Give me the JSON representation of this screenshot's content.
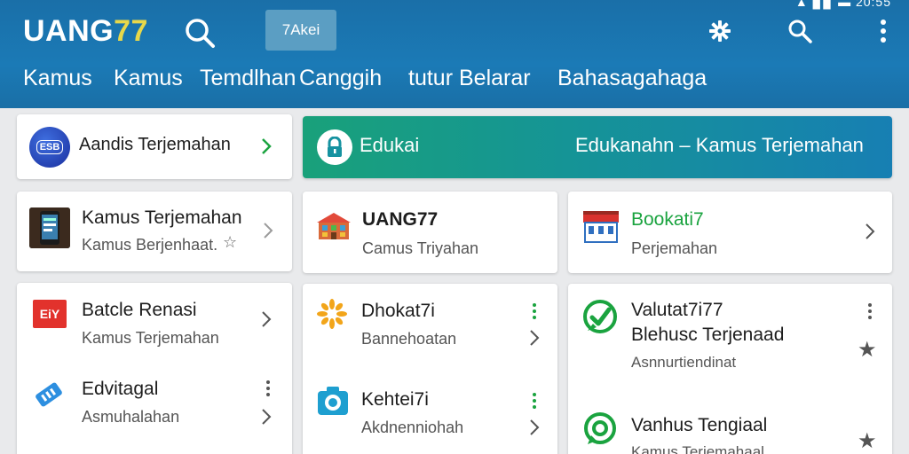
{
  "header": {
    "status_text": "▲ ▊▊ ▬ 20:55",
    "logo_main": "UANG",
    "logo_accent": "77",
    "search_chip": "7Akei",
    "nav": [
      "Kamus",
      "Kamus",
      "Temdlhan",
      "Canggih",
      "tutur",
      "Belarar",
      "Bahasagahaga"
    ]
  },
  "top_card": {
    "title": "Aandis Terjemahan",
    "icon_text": "ESB"
  },
  "banner": {
    "left_text": "Edukai",
    "right_text": "Edukanahn  –  Kamus Terjemahan"
  },
  "row1": [
    {
      "title": "Kamus Terjemahan",
      "subtitle": "Kamus Berjenhaat.",
      "star": "☆"
    },
    {
      "title": "UANG77",
      "subtitle": "Camus Triyahan"
    },
    {
      "title": "Bookati7",
      "subtitle": "Perjemahan"
    }
  ],
  "col1": [
    {
      "title": "Batcle Renasi",
      "subtitle": "Kamus Terjemahan",
      "icon_text": "EiY"
    },
    {
      "title": "Edvitagal",
      "subtitle": "Asmuhalahan"
    }
  ],
  "col2": [
    {
      "title": "Dhokat7i",
      "subtitle": "Bannehoatan"
    },
    {
      "title": "Kehtei7i",
      "subtitle": "Akdnenniohah"
    }
  ],
  "col3": [
    {
      "title": "Valutat7i77",
      "title2": "Blehusc Terjenaad",
      "subtitle": "Asnnurtiendinat",
      "star": "★"
    },
    {
      "title": "Vanhus Tengiaal",
      "subtitle": "Kamus Terjemahaal",
      "star": "★"
    }
  ],
  "colors": {
    "header": "#1a6fa8",
    "green": "#1aa33f",
    "orange": "#f2a51a",
    "teal": "#1aa37e"
  }
}
